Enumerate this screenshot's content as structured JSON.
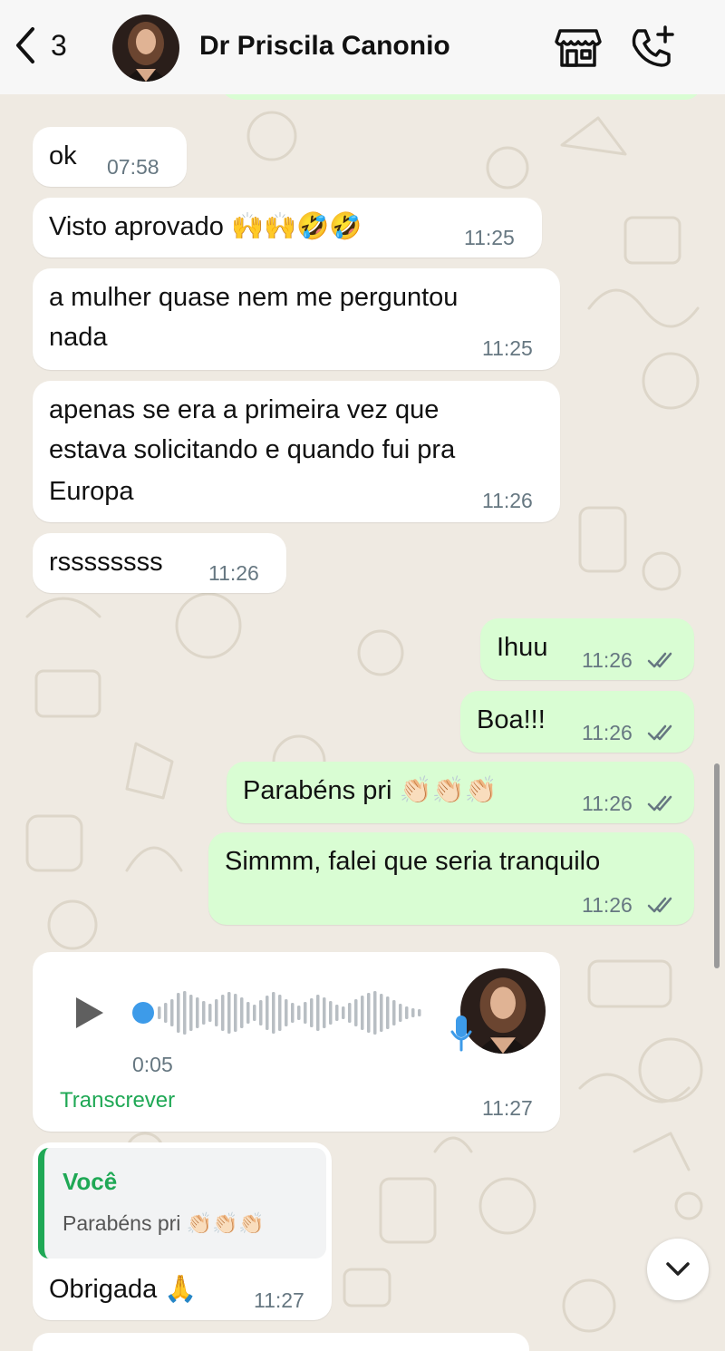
{
  "header": {
    "back_count": "3",
    "contact_name": "Dr Priscila Canonio",
    "icons": [
      "back-chevron-icon",
      "store-icon",
      "add-call-icon"
    ]
  },
  "messages": [
    {
      "direction": "in",
      "text": "ok",
      "time": "07:58"
    },
    {
      "direction": "in",
      "text": "Visto aprovado 🙌🙌🤣🤣",
      "time": "11:25"
    },
    {
      "direction": "in",
      "text": "a mulher quase nem me perguntou nada",
      "line1": "a mulher quase nem me perguntou",
      "line2": "nada",
      "time": "11:25"
    },
    {
      "direction": "in",
      "line1": "apenas se era a primeira vez que",
      "line2": "estava solicitando e quando fui pra",
      "line3": "Europa",
      "time": "11:26"
    },
    {
      "direction": "in",
      "text": "rssssssss",
      "time": "11:26"
    },
    {
      "direction": "out",
      "text": "Ihuu",
      "time": "11:26"
    },
    {
      "direction": "out",
      "text": "Boa!!!",
      "time": "11:26"
    },
    {
      "direction": "out",
      "text": "Parabéns pri 👏🏻👏🏻👏🏻",
      "time": "11:26"
    },
    {
      "direction": "out",
      "text": "Simmm, falei que seria tranquilo",
      "time": "11:26"
    },
    {
      "direction": "in",
      "type": "voice",
      "duration": "0:05",
      "transcribe_label": "Transcrever",
      "time": "11:27"
    },
    {
      "direction": "in",
      "type": "reply",
      "quote_author": "Você",
      "quote_text": "Parabéns pri 👏🏻👏🏻👏🏻",
      "text": "Obrigada 🙏",
      "time": "11:27"
    }
  ],
  "colors": {
    "chat_background": "#efeae2",
    "incoming_bubble": "#ffffff",
    "outgoing_bubble": "#d9fdd3",
    "accent_green": "#1fa855",
    "voice_blue": "#3d9be9",
    "time_gray": "#667781"
  }
}
